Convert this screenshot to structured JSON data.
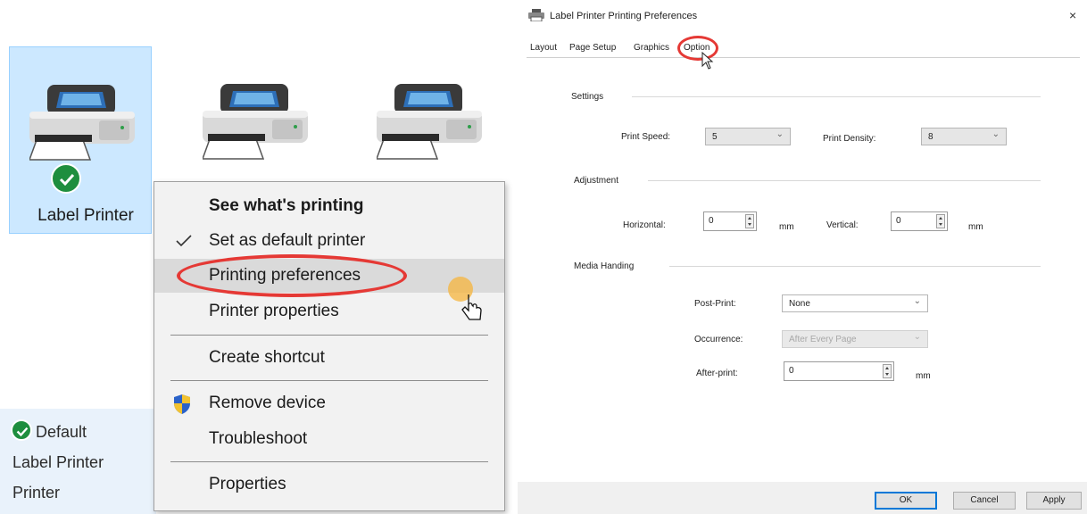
{
  "devices": {
    "selected_printer_label": "Label Printer",
    "details": {
      "line1": "Default",
      "line2": "Label Printer",
      "line3": "Printer"
    }
  },
  "context_menu": {
    "items": [
      {
        "label": "See what's printing"
      },
      {
        "label": "Set as default printer"
      },
      {
        "label": "Printing preferences"
      },
      {
        "label": "Printer properties"
      },
      {
        "label": "Create shortcut"
      },
      {
        "label": "Remove device"
      },
      {
        "label": "Troubleshoot"
      },
      {
        "label": "Properties"
      }
    ]
  },
  "dialog": {
    "title": "Label Printer Printing Preferences",
    "close_glyph": "×",
    "tabs": [
      "Layout",
      "Page Setup",
      "Graphics",
      "Option"
    ],
    "active_tab": "Option",
    "settings": {
      "title": "Settings",
      "print_speed_label": "Print Speed:",
      "print_speed_value": "5",
      "print_density_label": "Print Density:",
      "print_density_value": "8"
    },
    "adjustment": {
      "title": "Adjustment",
      "horizontal_label": "Horizontal:",
      "horizontal_value": "0",
      "horizontal_unit": "mm",
      "vertical_label": "Vertical:",
      "vertical_value": "0",
      "vertical_unit": "mm"
    },
    "media": {
      "title": "Media Handing",
      "post_print_label": "Post-Print:",
      "post_print_value": "None",
      "occurrence_label": "Occurrence:",
      "occurrence_value": "After Every Page",
      "after_print_label": "After-print:",
      "after_print_value": "0",
      "after_print_unit": "mm"
    },
    "buttons": {
      "ok": "OK",
      "cancel": "Cancel",
      "apply": "Apply"
    }
  },
  "colors": {
    "selection": "#cce8ff",
    "highlight_oval": "#e53935",
    "check_green": "#1e8e3e",
    "menu_bg": "#f2f2f2"
  },
  "icons": {
    "printer": "printer-icon",
    "check": "check-circle-icon",
    "shield": "shield-icon",
    "cursor": "mouse-pointer-icon"
  }
}
